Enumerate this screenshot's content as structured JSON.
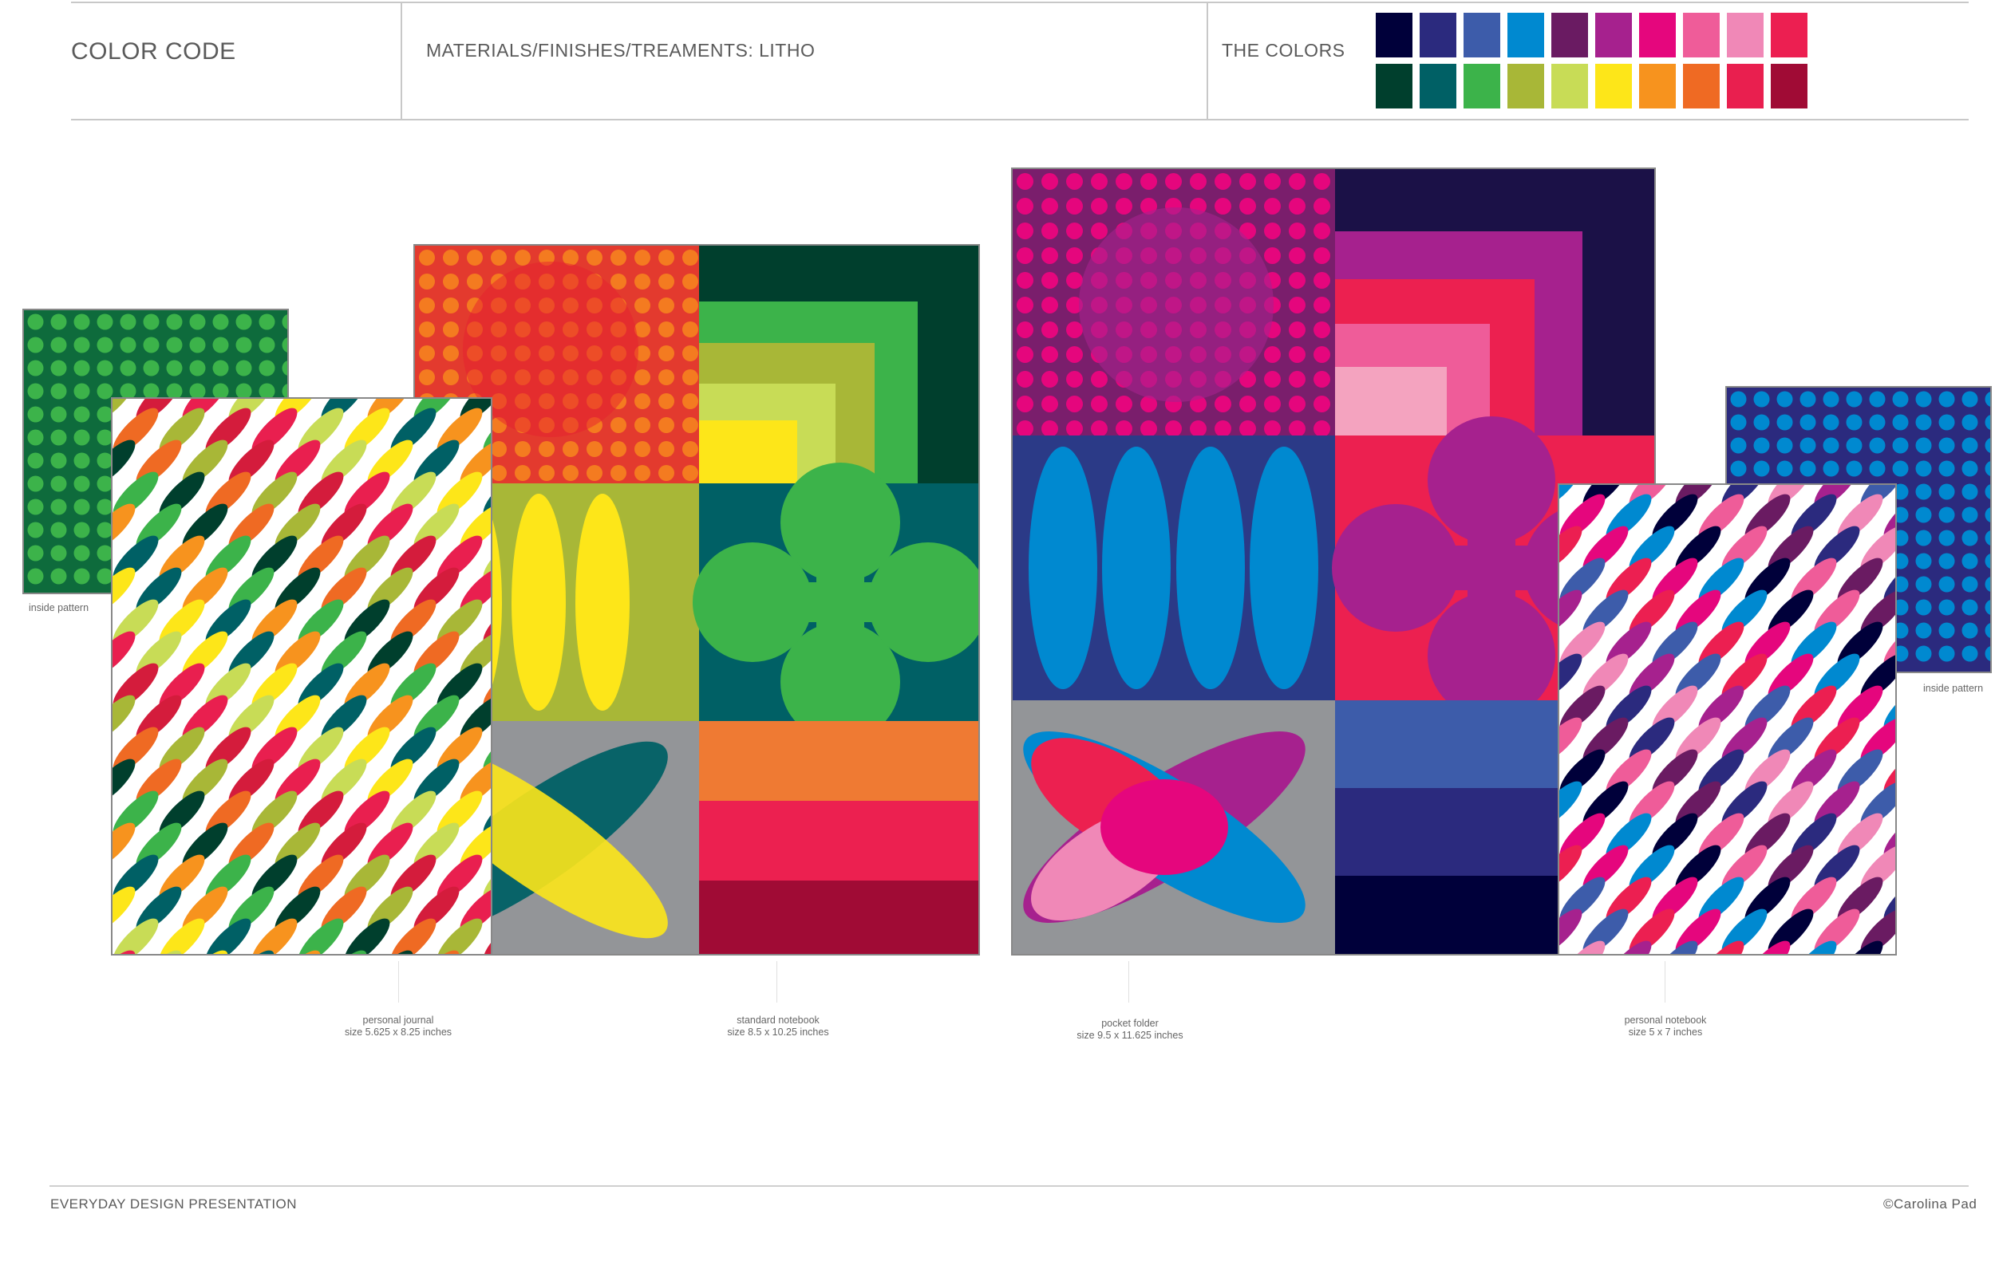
{
  "header": {
    "color_code": "COLOR CODE",
    "materials": "MATERIALS/FINISHES/TREAMENTS: LITHO",
    "the_colors": "THE COLORS"
  },
  "palette": {
    "row1": [
      "#00003a",
      "#2b2a7e",
      "#3d5caa",
      "#0089d0",
      "#6a1b62",
      "#a6218e",
      "#e5067d",
      "#ef5c99",
      "#f088b7",
      "#ec1f51"
    ],
    "row2": [
      "#003f2d",
      "#006065",
      "#3cb34a",
      "#a8b737",
      "#c8dc56",
      "#fde619",
      "#f7931e",
      "#ef6a23",
      "#e91f4f",
      "#a00b35"
    ]
  },
  "products": [
    {
      "name": "personal journal",
      "size": "size 5.625 x 8.25 inches"
    },
    {
      "name": "standard notebook",
      "size": "size 8.5 x 10.25 inches"
    },
    {
      "name": "pocket folder",
      "size": "size 9.5 x 11.625 inches"
    },
    {
      "name": "personal notebook",
      "size": "size 5 x 7 inches"
    }
  ],
  "labels": {
    "inside_left": "inside pattern",
    "inside_right": "inside pattern"
  },
  "footer": {
    "left": "EVERYDAY DESIGN PRESENTATION",
    "right": "©Carolina Pad"
  }
}
